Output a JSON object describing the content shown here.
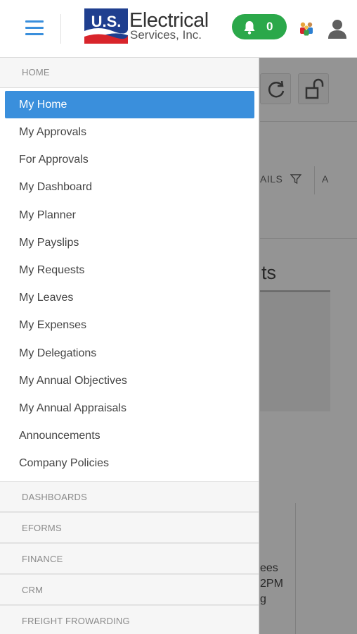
{
  "header": {
    "logo_line1": "Electrical",
    "logo_line2": "Services, Inc.",
    "logo_mark_text": "U.S.",
    "notification_count": "0",
    "colors": {
      "accent": "#3a8fdc",
      "notif_green": "#2ba84a",
      "logo_blue": "#1f3f8f",
      "logo_red": "#d8242b"
    }
  },
  "drawer": {
    "home_section": "HOME",
    "items": [
      {
        "label": "My Home",
        "active": true
      },
      {
        "label": "My Approvals"
      },
      {
        "label": "For Approvals"
      },
      {
        "label": "My Dashboard"
      },
      {
        "label": "My Planner"
      },
      {
        "label": "My Payslips"
      },
      {
        "label": "My Requests"
      },
      {
        "label": "My Leaves"
      },
      {
        "label": "My Expenses"
      },
      {
        "label": "My Delegations"
      },
      {
        "label": "My Annual Objectives"
      },
      {
        "label": "My Annual Appraisals"
      },
      {
        "label": "Announcements"
      },
      {
        "label": "Company Policies"
      }
    ],
    "sections": [
      "DASHBOARDS",
      "EFORMS",
      "FINANCE",
      "CRM",
      "FREIGHT FROWARDING"
    ]
  },
  "background": {
    "filter_text": "AILS",
    "filter_letter": "A",
    "heading_fragment": "ts",
    "text_1": "ees",
    "text_2": "2PM",
    "text_3": "g"
  }
}
